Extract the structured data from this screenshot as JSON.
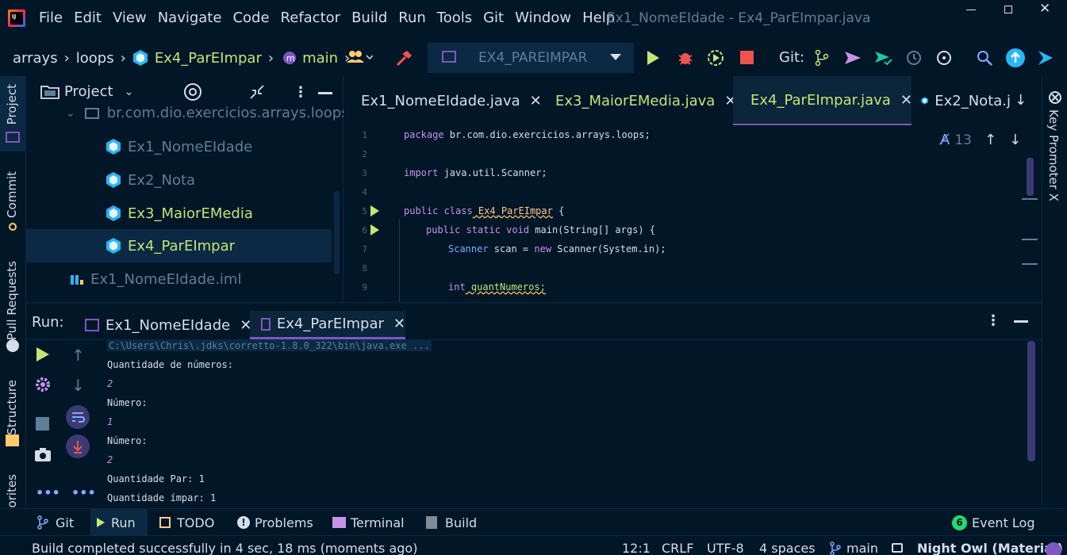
{
  "titlebar": {
    "menu": [
      "File",
      "Edit",
      "View",
      "Navigate",
      "Code",
      "Refactor",
      "Build",
      "Run",
      "Tools",
      "Git",
      "Window",
      "Help"
    ],
    "window_title": "Ex1_NomeEIdade - Ex4_ParEImpar.java"
  },
  "navbar": {
    "crumbs": [
      "arrays",
      "loops",
      "Ex4_ParEImpar",
      "main"
    ],
    "run_config": "EX4_PAREIMPAR",
    "git_label": "Git:"
  },
  "left_tools": {
    "project": "Project",
    "commit": "Commit",
    "pull_requests": "Pull Requests",
    "structure": "Structure",
    "favorites": "orites"
  },
  "project": {
    "header": "Project",
    "items": [
      {
        "label": "br.com.dio.exercicios.arrays.loops"
      },
      {
        "label": "Ex1_NomeEIdade"
      },
      {
        "label": "Ex2_Nota"
      },
      {
        "label": "Ex3_MaiorEMedia"
      },
      {
        "label": "Ex4_ParEImpar"
      },
      {
        "label": "Ex1_NomeEIdade.iml"
      }
    ]
  },
  "editor": {
    "tabs": [
      {
        "label": "Ex1_NomeEIdade.java"
      },
      {
        "label": "Ex3_MaiorEMedia.java"
      },
      {
        "label": "Ex4_ParEImpar.java"
      },
      {
        "label": "Ex2_Nota.j"
      }
    ],
    "inspection_count": "13",
    "line_numbers": [
      "1",
      "2",
      "3",
      "4",
      "5",
      "6",
      "7",
      "8",
      "9"
    ],
    "lines": {
      "l1_kw": "package",
      "l1_rest": " br.com.dio.exercicios.arrays.loops;",
      "l3_kw": "import",
      "l3_rest": " java.util.Scanner;",
      "l5_kw": "public class",
      "l5_name": " Ex4_ParEImpar",
      "l5_rest": " {",
      "l6_kw": "public static void",
      "l6_rest": " main(String[] args) {",
      "l7_type": "Scanner",
      "l7_mid": " scan = ",
      "l7_kw": "new",
      "l7_rest": " Scanner(System.in);",
      "l9_kw": "int",
      "l9_rest": " quantNumeros;"
    }
  },
  "right_strip": {
    "key_promoter": "Key Promoter X"
  },
  "run": {
    "label": "Run:",
    "tabs": [
      {
        "label": "Ex1_NomeEIdade"
      },
      {
        "label": "Ex4_ParEImpar"
      }
    ],
    "console": [
      "C:\\Users\\Chris\\.jdks\\corretto-1.8.0_322\\bin\\java.exe ...",
      "Quantidade de números:",
      "2",
      "Número:",
      "1",
      "Número:",
      "2",
      "Quantidade Par: 1",
      "Quantidade ímpar: 1"
    ]
  },
  "bottom_tools": {
    "git": "Git",
    "run": "Run",
    "todo": "TODO",
    "problems": "Problems",
    "terminal": "Terminal",
    "build": "Build",
    "event_log_count": "6",
    "event_log": "Event Log"
  },
  "status": {
    "message": "Build completed successfully in 4 sec, 18 ms (moments ago)",
    "position": "12:1",
    "line_sep": "CRLF",
    "encoding": "UTF-8",
    "indent": "4 spaces",
    "branch": "main",
    "theme": "Night Owl (Material)"
  },
  "colors": {
    "background": "#011627",
    "accent_purple": "#7e57c2",
    "java_icon": "#29b6f6",
    "run_green": "#c5e478",
    "stop_red": "#ef5350"
  }
}
